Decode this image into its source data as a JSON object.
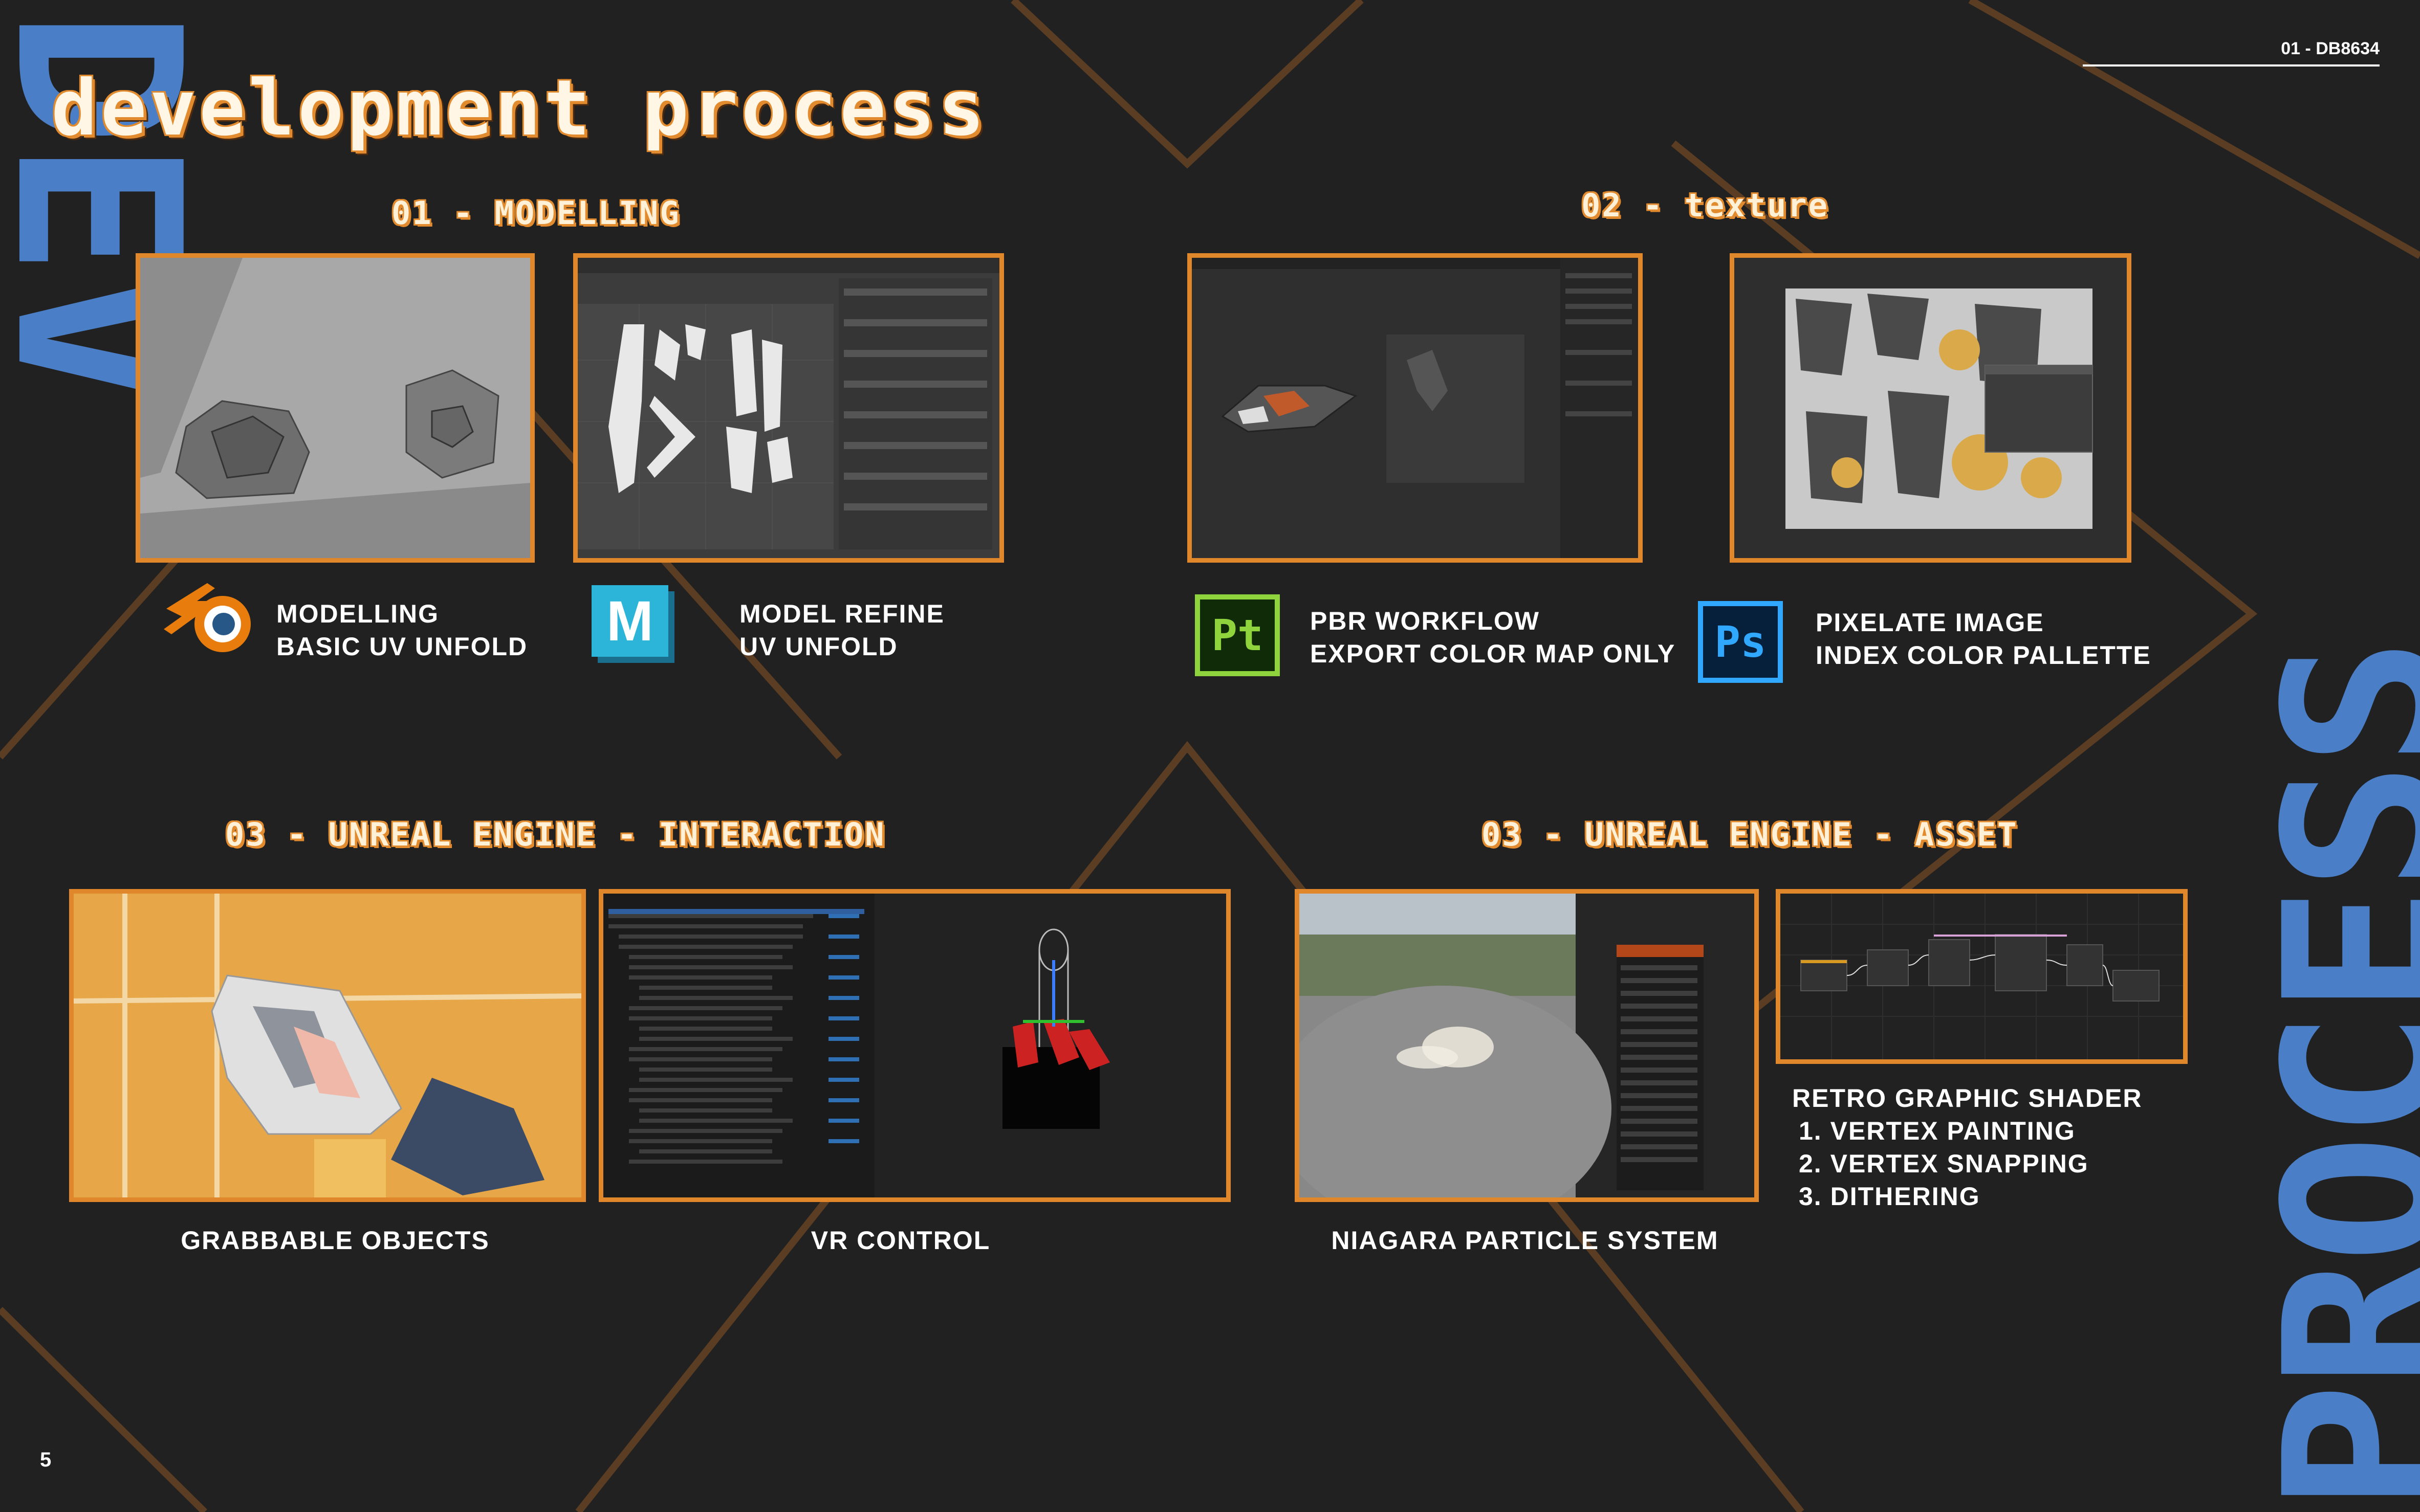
{
  "header": {
    "title": "development process",
    "doc_code": "01 - DB8634"
  },
  "side_text": {
    "left": "DEV",
    "right": "PROCESS"
  },
  "page_number": "5",
  "sections": {
    "modelling": {
      "title": "01 - modelling"
    },
    "texture": {
      "title": "02 - texture"
    },
    "ue_interaction": {
      "title": "03 - UNREAL ENGINE - INTERACTION"
    },
    "ue_asset": {
      "title": "03 - UNREAL ENGINE - ASSET"
    }
  },
  "tools": {
    "blender": {
      "icon": "blender-icon",
      "line1": "MODELLING",
      "line2": "BASIC UV UNFOLD"
    },
    "maya": {
      "icon": "maya-icon",
      "icon_letter": "M",
      "line1": "MODEL REFINE",
      "line2": "UV UNFOLD"
    },
    "substance": {
      "icon": "substance-painter-icon",
      "icon_letters": "Pt",
      "line1": "PBR WORKFLOW",
      "line2": "EXPORT COLOR MAP ONLY"
    },
    "photoshop": {
      "icon": "photoshop-icon",
      "icon_letters": "Ps",
      "line1": "PIXELATE IMAGE",
      "line2": "INDEX COLOR PALLETTE"
    }
  },
  "captions": {
    "grabbable": "GRABBABLE OBJECTS",
    "vr_control": "VR CONTROL",
    "niagara": "NIAGARA PARTICLE SYSTEM"
  },
  "shader": {
    "title": "RETRO GRAPHIC SHADER",
    "items": [
      "1. VERTEX PAINTING",
      "2. VERTEX SNAPPING",
      "3. DITHERING"
    ]
  },
  "colors": {
    "accent": "#e0862b",
    "background": "#212121",
    "blue": "#4a7fc7",
    "text": "#ffffff"
  }
}
